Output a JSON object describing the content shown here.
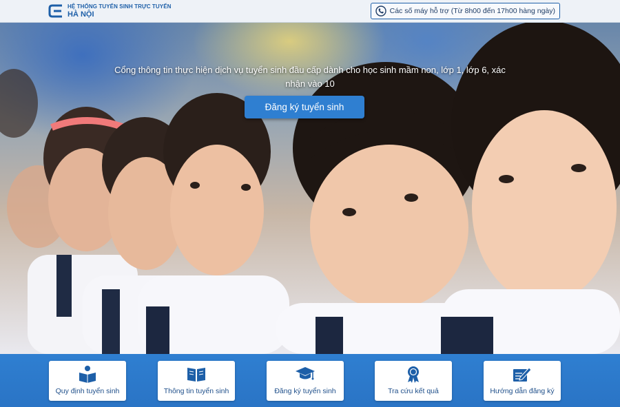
{
  "header": {
    "brand_top": "HỆ THỐNG TUYỂN SINH TRỰC TUYẾN",
    "brand_bottom": "HÀ NỘI",
    "support_text": "Các số máy hỗ trợ (Từ 8h00 đến 17h00 hàng ngày)",
    "support_icon": "phone-icon"
  },
  "hero": {
    "tagline": "Cổng thông tin thực hiện dịch vụ tuyển sinh đầu cấp dành cho học sinh mầm non, lớp 1, lớp 6, xác nhận vào 10",
    "cta_label": "Đăng ký tuyển sinh"
  },
  "cards": [
    {
      "label": "Quy định tuyển sinh",
      "icon": "reader-icon"
    },
    {
      "label": "Thông tin tuyển sinh",
      "icon": "open-book-icon"
    },
    {
      "label": "Đăng ký tuyển sinh",
      "icon": "graduation-cap-icon"
    },
    {
      "label": "Tra cứu kết quả",
      "icon": "award-medal-icon"
    },
    {
      "label": "Hướng dẫn đăng ký",
      "icon": "edit-pen-icon"
    }
  ],
  "colors": {
    "brand": "#1d5fa8",
    "band": "#2f7fd1",
    "cta": "#2f7fd1"
  }
}
